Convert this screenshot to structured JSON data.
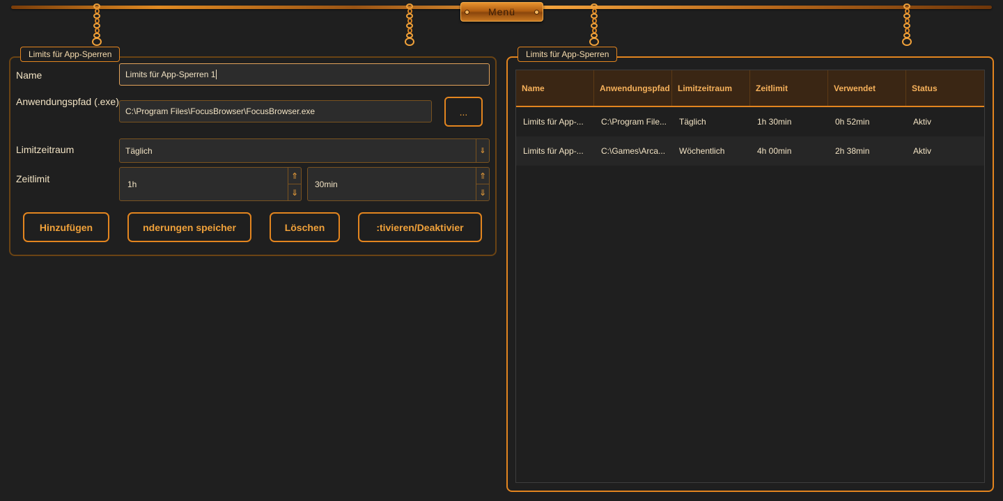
{
  "menu": {
    "label": "Menü"
  },
  "left_panel": {
    "title": "Limits für App-Sperren",
    "form": {
      "name_label": "Name",
      "name_value": "Limits für App-Sperren 1",
      "path_label": "Anwendungspfad (.exe)",
      "path_value": "C:\\Program Files\\FocusBrowser\\FocusBrowser.exe",
      "browse_label": "...",
      "period_label": "Limitzeitraum",
      "period_value": "Täglich",
      "limit_label": "Zeitlimit",
      "hours_value": "1h",
      "minutes_value": "30min"
    },
    "buttons": {
      "add": "Hinzufügen",
      "save": "nderungen speicher",
      "delete": "Löschen",
      "toggle": ":tivieren/Deaktivier"
    }
  },
  "right_panel": {
    "title": "Limits für App-Sperren",
    "table": {
      "headers": [
        "Name",
        "Anwendungspfad",
        "Limitzeitraum",
        "Zeitlimit",
        "Verwendet",
        "Status"
      ],
      "rows": [
        [
          "Limits für App-...",
          "C:\\Program File...",
          "Täglich",
          "1h 30min",
          "0h 52min",
          "Aktiv"
        ],
        [
          "Limits für App-...",
          "C:\\Games\\Arca...",
          "Wöchentlich",
          "4h 00min",
          "2h 38min",
          "Aktiv"
        ]
      ]
    }
  },
  "icons": {
    "combo_arrow": "arrow-down-icon",
    "spin_up": "arrow-up-icon",
    "spin_down": "arrow-down-icon"
  },
  "colors": {
    "accent": "#e3851f",
    "background": "#1f1f1f",
    "header_bg": "#3a2614"
  }
}
